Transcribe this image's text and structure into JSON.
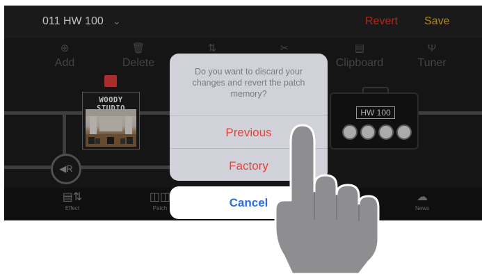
{
  "topbar": {
    "patch_name": "011 HW 100",
    "revert": "Revert",
    "save": "Save"
  },
  "toolbar": {
    "items": [
      {
        "label": "Add",
        "icon": "plus-circle-icon"
      },
      {
        "label": "Delete",
        "icon": "trash-icon"
      },
      {
        "label": "",
        "icon": "move-icon"
      },
      {
        "label": "",
        "icon": "scissors-icon"
      },
      {
        "label": "Clipboard",
        "icon": "clipboard-icon"
      },
      {
        "label": "Tuner",
        "icon": "tuning-fork-icon"
      }
    ]
  },
  "chain": {
    "effect_name": "WOODY STUDIO",
    "amp_name": "HW 100",
    "loop_label": "R"
  },
  "tabbar": {
    "tabs": [
      {
        "label": "Effect",
        "icon": "effect-icon"
      },
      {
        "label": "Patch",
        "icon": "patch-icon"
      },
      {
        "label": "News",
        "icon": "cloud-download-icon"
      }
    ]
  },
  "alert": {
    "message": "Do you want to discard your changes and revert the patch memory?",
    "option_previous": "Previous",
    "option_factory": "Factory",
    "cancel": "Cancel"
  },
  "colors": {
    "revert": "#e8342b",
    "save": "#e9b92c",
    "destructive": "#ea3f35",
    "cancel": "#2f6dd9"
  }
}
